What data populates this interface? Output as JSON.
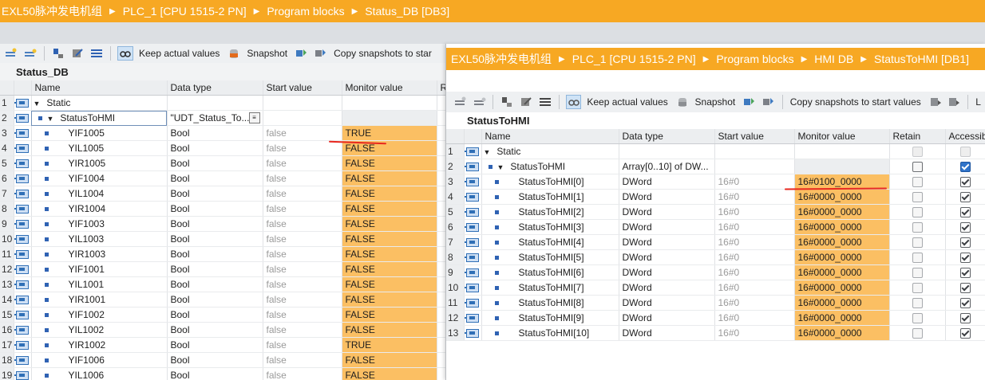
{
  "left": {
    "breadcrumb": [
      "EXL50脉冲发电机组",
      "PLC_1 [CPU 1515-2 PN]",
      "Program blocks",
      "Status_DB [DB3]"
    ],
    "toolbar": {
      "keep_actual": "Keep actual values",
      "snapshot": "Snapshot",
      "copy_snapshots": "Copy snapshots to star"
    },
    "block_title": "Status_DB",
    "columns": [
      "Name",
      "Data type",
      "Start value",
      "Monitor value",
      "R"
    ],
    "rows": [
      {
        "n": "1",
        "name": "Static",
        "type": "",
        "start": "",
        "mon": ""
      },
      {
        "n": "2",
        "name": "StatusToHMI",
        "type": "\"UDT_Status_To...",
        "start": "",
        "mon": ""
      },
      {
        "n": "3",
        "name": "YIF1005",
        "type": "Bool",
        "start": "false",
        "mon": "TRUE"
      },
      {
        "n": "4",
        "name": "YIL1005",
        "type": "Bool",
        "start": "false",
        "mon": "FALSE"
      },
      {
        "n": "5",
        "name": "YIR1005",
        "type": "Bool",
        "start": "false",
        "mon": "FALSE"
      },
      {
        "n": "6",
        "name": "YIF1004",
        "type": "Bool",
        "start": "false",
        "mon": "FALSE"
      },
      {
        "n": "7",
        "name": "YIL1004",
        "type": "Bool",
        "start": "false",
        "mon": "FALSE"
      },
      {
        "n": "8",
        "name": "YIR1004",
        "type": "Bool",
        "start": "false",
        "mon": "FALSE"
      },
      {
        "n": "9",
        "name": "YIF1003",
        "type": "Bool",
        "start": "false",
        "mon": "FALSE"
      },
      {
        "n": "10",
        "name": "YIL1003",
        "type": "Bool",
        "start": "false",
        "mon": "FALSE"
      },
      {
        "n": "11",
        "name": "YIR1003",
        "type": "Bool",
        "start": "false",
        "mon": "FALSE"
      },
      {
        "n": "12",
        "name": "YIF1001",
        "type": "Bool",
        "start": "false",
        "mon": "FALSE"
      },
      {
        "n": "13",
        "name": "YIL1001",
        "type": "Bool",
        "start": "false",
        "mon": "FALSE"
      },
      {
        "n": "14",
        "name": "YIR1001",
        "type": "Bool",
        "start": "false",
        "mon": "FALSE"
      },
      {
        "n": "15",
        "name": "YIF1002",
        "type": "Bool",
        "start": "false",
        "mon": "FALSE"
      },
      {
        "n": "16",
        "name": "YIL1002",
        "type": "Bool",
        "start": "false",
        "mon": "FALSE"
      },
      {
        "n": "17",
        "name": "YIR1002",
        "type": "Bool",
        "start": "false",
        "mon": "TRUE"
      },
      {
        "n": "18",
        "name": "YIF1006",
        "type": "Bool",
        "start": "false",
        "mon": "FALSE"
      },
      {
        "n": "19",
        "name": "YIL1006",
        "type": "Bool",
        "start": "false",
        "mon": "FALSE"
      }
    ]
  },
  "right": {
    "breadcrumb": [
      "EXL50脉冲发电机组",
      "PLC_1 [CPU 1515-2 PN]",
      "Program blocks",
      "HMI DB",
      "StatusToHMI [DB1]"
    ],
    "toolbar": {
      "keep_actual": "Keep actual values",
      "snapshot": "Snapshot",
      "copy_snapshots": "Copy snapshots to start values",
      "trailing": "L"
    },
    "block_title": "StatusToHMI",
    "columns": [
      "Name",
      "Data type",
      "Start value",
      "Monitor value",
      "Retain",
      "Accessible"
    ],
    "rows": [
      {
        "n": "1",
        "name": "Static",
        "type": "",
        "start": "",
        "mon": ""
      },
      {
        "n": "2",
        "name": "StatusToHMI",
        "type": "Array[0..10] of DW...",
        "start": "",
        "mon": ""
      },
      {
        "n": "3",
        "name": "StatusToHMI[0]",
        "type": "DWord",
        "start": "16#0",
        "mon": "16#0100_0000"
      },
      {
        "n": "4",
        "name": "StatusToHMI[1]",
        "type": "DWord",
        "start": "16#0",
        "mon": "16#0000_0000"
      },
      {
        "n": "5",
        "name": "StatusToHMI[2]",
        "type": "DWord",
        "start": "16#0",
        "mon": "16#0000_0000"
      },
      {
        "n": "6",
        "name": "StatusToHMI[3]",
        "type": "DWord",
        "start": "16#0",
        "mon": "16#0000_0000"
      },
      {
        "n": "7",
        "name": "StatusToHMI[4]",
        "type": "DWord",
        "start": "16#0",
        "mon": "16#0000_0000"
      },
      {
        "n": "8",
        "name": "StatusToHMI[5]",
        "type": "DWord",
        "start": "16#0",
        "mon": "16#0000_0000"
      },
      {
        "n": "9",
        "name": "StatusToHMI[6]",
        "type": "DWord",
        "start": "16#0",
        "mon": "16#0000_0000"
      },
      {
        "n": "10",
        "name": "StatusToHMI[7]",
        "type": "DWord",
        "start": "16#0",
        "mon": "16#0000_0000"
      },
      {
        "n": "11",
        "name": "StatusToHMI[8]",
        "type": "DWord",
        "start": "16#0",
        "mon": "16#0000_0000"
      },
      {
        "n": "12",
        "name": "StatusToHMI[9]",
        "type": "DWord",
        "start": "16#0",
        "mon": "16#0000_0000"
      },
      {
        "n": "13",
        "name": "StatusToHMI[10]",
        "type": "DWord",
        "start": "16#0",
        "mon": "16#0000_0000"
      }
    ]
  },
  "colors": {
    "breadcrumb": "#f7a823",
    "monitor_cell": "#fbbf63",
    "annotation": "#e8281f"
  }
}
